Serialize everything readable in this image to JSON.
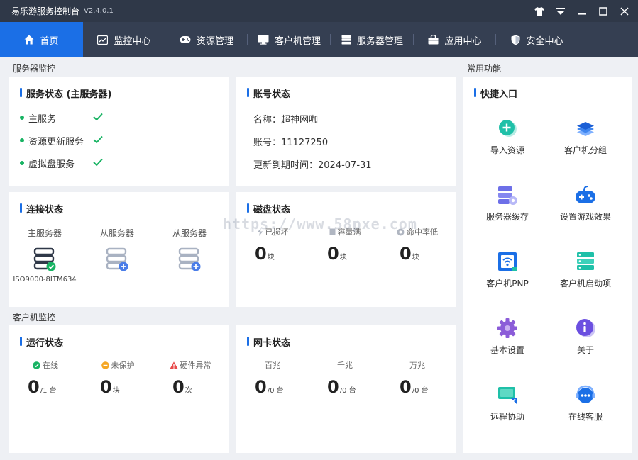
{
  "window": {
    "title": "易乐游服务控制台",
    "version": "V2.4.0.1",
    "controls": [
      "shirt-icon",
      "dropdown-icon",
      "minimize-icon",
      "maximize-icon",
      "close-icon"
    ]
  },
  "nav": {
    "items": [
      {
        "label": "首页",
        "icon": "home-icon",
        "active": true
      },
      {
        "label": "监控中心",
        "icon": "monitor-chart-icon"
      },
      {
        "label": "资源管理",
        "icon": "gamepad-icon"
      },
      {
        "label": "客户机管理",
        "icon": "desktop-icon"
      },
      {
        "label": "服务器管理",
        "icon": "server-icon"
      },
      {
        "label": "应用中心",
        "icon": "bag-icon"
      },
      {
        "label": "安全中心",
        "icon": "shield-icon"
      }
    ]
  },
  "sections": {
    "server_monitor": "服务器监控",
    "client_monitor": "客户机监控",
    "common_functions": "常用功能"
  },
  "service_status": {
    "title": "服务状态 (主服务器)",
    "items": [
      "主服务",
      "资源更新服务",
      "虚拟盘服务"
    ]
  },
  "account_status": {
    "title": "账号状态",
    "rows": [
      "名称：超神网咖",
      "账号：11127250",
      "更新到期时间：2024-07-31"
    ]
  },
  "connection_status": {
    "title": "连接状态",
    "servers": [
      {
        "label": "主服务器",
        "sub": "ISO9000-8ITM634",
        "state": "ok"
      },
      {
        "label": "从服务器",
        "sub": "",
        "state": "add"
      },
      {
        "label": "从服务器",
        "sub": "",
        "state": "add"
      }
    ]
  },
  "disk_status": {
    "title": "磁盘状态",
    "stats": [
      {
        "label": "已损坏",
        "value": "0",
        "unit": "块"
      },
      {
        "label": "容量满",
        "value": "0",
        "unit": "块"
      },
      {
        "label": "命中率低",
        "value": "0",
        "unit": "块"
      }
    ]
  },
  "run_status": {
    "title": "运行状态",
    "stats": [
      {
        "label": "在线",
        "value": "0",
        "unit": "/1 台",
        "color": "#18b363"
      },
      {
        "label": "未保护",
        "value": "0",
        "unit": "块",
        "color": "#f5a623"
      },
      {
        "label": "硬件异常",
        "value": "0",
        "unit": "次",
        "color": "#e84a4a"
      }
    ]
  },
  "nic_status": {
    "title": "网卡状态",
    "stats": [
      {
        "label": "百兆",
        "value": "0",
        "unit": "/0 台"
      },
      {
        "label": "千兆",
        "value": "0",
        "unit": "/0 台"
      },
      {
        "label": "万兆",
        "value": "0",
        "unit": "/0 台"
      }
    ]
  },
  "quick_entry": {
    "title": "快捷入口",
    "items": [
      {
        "label": "导入资源",
        "icon": "import-plus-icon"
      },
      {
        "label": "客户机分组",
        "icon": "layers-icon"
      },
      {
        "label": "服务器缓存",
        "icon": "server-cache-icon"
      },
      {
        "label": "设置游戏效果",
        "icon": "game-controller-icon"
      },
      {
        "label": "客户机PNP",
        "icon": "pnp-icon"
      },
      {
        "label": "客户机启动项",
        "icon": "startup-stack-icon"
      },
      {
        "label": "基本设置",
        "icon": "gear-icon"
      },
      {
        "label": "关于",
        "icon": "info-icon"
      },
      {
        "label": "远程协助",
        "icon": "remote-screen-icon"
      },
      {
        "label": "在线客服",
        "icon": "chat-support-icon"
      }
    ]
  },
  "colors": {
    "accent": "#1b6fe6",
    "titlebar": "#2f3848",
    "navbar": "#353f52",
    "ok": "#18b363"
  },
  "watermark": "https://www.58pxe.com"
}
